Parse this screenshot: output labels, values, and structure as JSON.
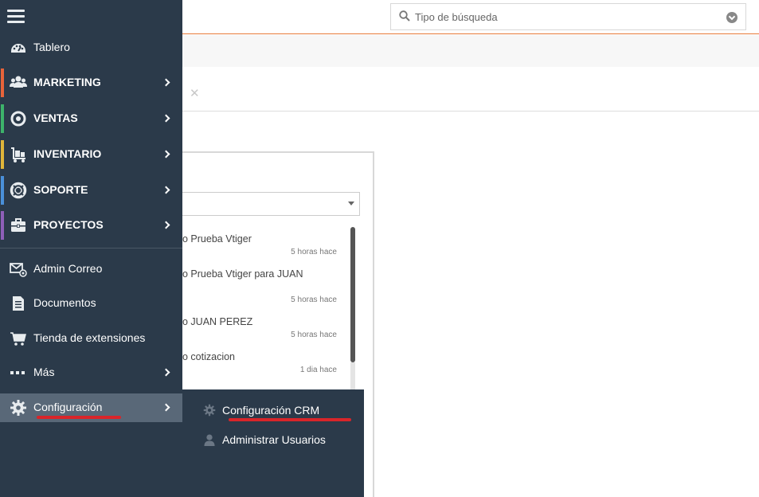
{
  "search": {
    "placeholder": "Tipo de búsqueda"
  },
  "menu": {
    "items": [
      {
        "label": "Tablero",
        "icon": "dashboard-icon",
        "bar_color": "",
        "has_submenu": false
      },
      {
        "label": "MARKETING",
        "icon": "users-icon",
        "bar_color": "#e8643a",
        "has_submenu": true
      },
      {
        "label": "VENTAS",
        "icon": "target-icon",
        "bar_color": "#3db36b",
        "has_submenu": true
      },
      {
        "label": "INVENTARIO",
        "icon": "cart-dolly-icon",
        "bar_color": "#e0b53a",
        "has_submenu": true
      },
      {
        "label": "SOPORTE",
        "icon": "lifebuoy-icon",
        "bar_color": "#4a90d9",
        "has_submenu": true
      },
      {
        "label": "PROYECTOS",
        "icon": "briefcase-icon",
        "bar_color": "#8e5fb8",
        "has_submenu": true
      },
      {
        "label": "Admin Correo",
        "icon": "mail-at-icon",
        "has_submenu": false
      },
      {
        "label": "Documentos",
        "icon": "document-icon",
        "has_submenu": false
      },
      {
        "label": "Tienda de extensiones",
        "icon": "shopping-cart-icon",
        "has_submenu": false
      },
      {
        "label": "Más",
        "icon": "ellipsis-icon",
        "has_submenu": true
      },
      {
        "label": "Configuración",
        "icon": "gear-icon",
        "has_submenu": true,
        "active": true
      }
    ]
  },
  "submenu": {
    "items": [
      {
        "label": "Configuración CRM",
        "icon": "gear-icon"
      },
      {
        "label": "Administrar Usuarios",
        "icon": "user-icon"
      }
    ]
  },
  "activities": [
    {
      "title": "o Prueba Vtiger",
      "time": "5 horas hace"
    },
    {
      "title": "o Prueba Vtiger para JUAN",
      "time": "5 horas hace"
    },
    {
      "title": "o JUAN PEREZ",
      "time": "5 horas hace"
    },
    {
      "title": "o cotizacion",
      "time": "1 dia hace"
    }
  ],
  "colors": {
    "sidebar": "#2b3a4a",
    "accent": "#e87a3a",
    "highlight": "#d9252a"
  }
}
